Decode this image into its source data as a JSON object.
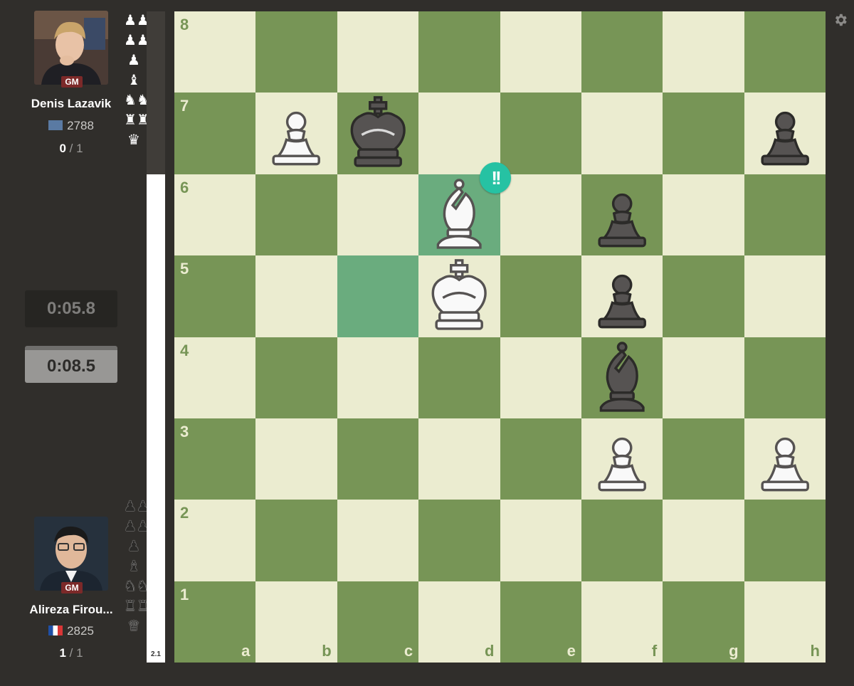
{
  "top_player": {
    "title_badge": "GM",
    "name": "Denis Lazavik",
    "rating": "2788",
    "score_won": "0",
    "score_total": " / 1",
    "captured_icons": [
      "♟♟",
      "♟♟",
      "♟",
      "♝",
      "♞♞",
      "♜♜",
      "♛"
    ]
  },
  "bottom_player": {
    "title_badge": "GM",
    "name": "Alireza Firou...",
    "rating": "2825",
    "score_won": "1",
    "score_total": " / 1",
    "captured_icons": [
      "♟♟",
      "♟♟",
      "♟",
      "♝",
      "♞♞",
      "♜♜",
      "♛"
    ]
  },
  "clocks": {
    "top": "0:05.8",
    "bottom": "0:08.5"
  },
  "eval_bar": {
    "value": "2.1",
    "white_fraction": 0.75
  },
  "board": {
    "ranks": [
      "8",
      "7",
      "6",
      "5",
      "4",
      "3",
      "2",
      "1"
    ],
    "files": [
      "a",
      "b",
      "c",
      "d",
      "e",
      "f",
      "g",
      "h"
    ],
    "highlighted_squares": [
      "d6",
      "c5"
    ],
    "pieces": [
      {
        "square": "b7",
        "color": "white",
        "type": "pawn"
      },
      {
        "square": "c7",
        "color": "black",
        "type": "king"
      },
      {
        "square": "h7",
        "color": "black",
        "type": "pawn"
      },
      {
        "square": "d6",
        "color": "white",
        "type": "bishop"
      },
      {
        "square": "f6",
        "color": "black",
        "type": "pawn"
      },
      {
        "square": "d5",
        "color": "white",
        "type": "king"
      },
      {
        "square": "f5",
        "color": "black",
        "type": "pawn"
      },
      {
        "square": "f4",
        "color": "black",
        "type": "bishop"
      },
      {
        "square": "f3",
        "color": "white",
        "type": "pawn"
      },
      {
        "square": "h3",
        "color": "white",
        "type": "pawn"
      }
    ],
    "move_annotation": {
      "square": "d6",
      "symbol": "!!",
      "color": "#26c2a3"
    }
  },
  "colors": {
    "light_square": "#ebecd0",
    "dark_square": "#779556",
    "highlight": "#6aac7e",
    "background": "#302e2b"
  }
}
